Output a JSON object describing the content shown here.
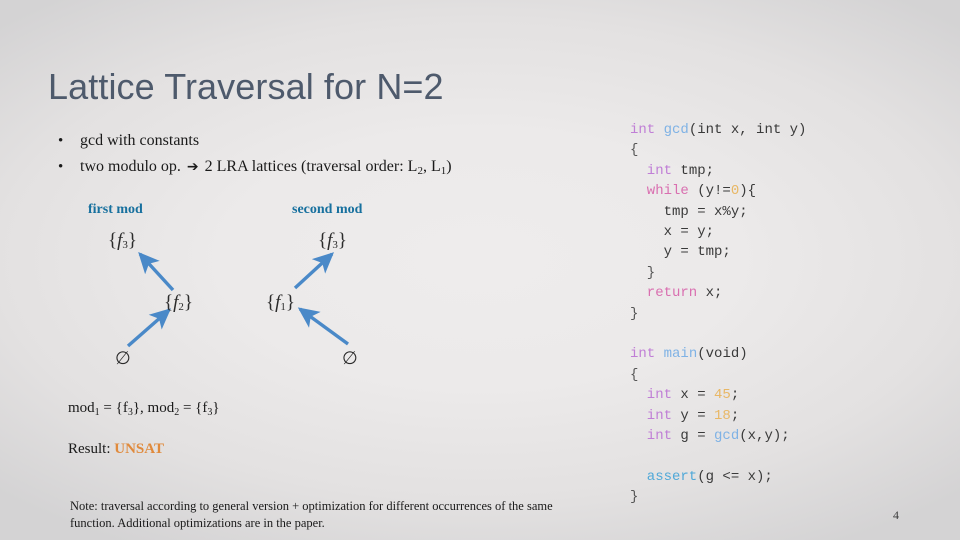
{
  "slide": {
    "title": "Lattice Traversal for N=2",
    "page_number": "4",
    "background_color": "#eceaea",
    "title_color": "#4e5a6c",
    "accent_blue": "#17709e",
    "arrow_color": "#4a89c8",
    "result_color": "#e08a3c"
  },
  "bullets": [
    {
      "marker": "•",
      "text": "gcd with constants"
    },
    {
      "marker": "•",
      "text_before_arrow": "two modulo op. ",
      "arrow": "➔",
      "text_after_arrow": " 2 LRA lattices (traversal order: L",
      "sub1": "2",
      "mid": ", L",
      "sub2": "1",
      "tail": ")"
    }
  ],
  "lattice": {
    "headers": [
      {
        "label": "first mod"
      },
      {
        "label": "second mod"
      }
    ],
    "left": {
      "top_node": {
        "open": "{",
        "fn": "f",
        "index": "3",
        "close": "}"
      },
      "mid_node": {
        "open": "{",
        "fn": "f",
        "index": "2",
        "close": "}"
      },
      "bottom_node": "∅"
    },
    "right": {
      "top_node": {
        "open": "{",
        "fn": "f",
        "index": "3",
        "close": "}"
      },
      "mid_node": {
        "open": "{",
        "fn": "f",
        "index": "1",
        "close": "}"
      },
      "bottom_node": "∅"
    }
  },
  "results": {
    "mod_line": {
      "m1_label": "mod",
      "m1_sub": "1",
      "m1_value": " = {f",
      "m1_value_sub": "3",
      "m1_value_end": "}, ",
      "m2_label": "mod",
      "m2_sub": "2",
      "m2_value": " = {f",
      "m2_value_sub": "3",
      "m2_value_end": "}"
    },
    "result_label": "Result: ",
    "result_verdict": "UNSAT"
  },
  "footnote": {
    "text": "Note: traversal according to general version + optimization for different occurrences of the same function. Additional optimizations are in the paper."
  },
  "code": {
    "gcd": {
      "line1_kw": "int",
      "line1_fn": " gcd",
      "line1_rest": "(int x, int y)",
      "line2": "{",
      "line3_kw": "  int",
      "line3_rest": " tmp;",
      "line4_kw": "  while",
      "line4_rest_a": " (y!=",
      "line4_num": "0",
      "line4_rest_b": "){",
      "line5": "    tmp = x%y;",
      "line6": "    x = y;",
      "line7": "    y = tmp;",
      "line8": "  }",
      "line9_kw": "  return",
      "line9_rest": " x;",
      "line10": "}"
    },
    "main": {
      "line1_kw": "int",
      "line1_fn": " main",
      "line1_rest": "(void)",
      "line2": "{",
      "line3_kw": "  int",
      "line3_mid": " x = ",
      "line3_num": "45",
      "line3_end": ";",
      "line4_kw": "  int",
      "line4_mid": " y = ",
      "line4_num": "18",
      "line4_end": ";",
      "line5_kw": "  int",
      "line5_mid": " g = ",
      "line5_fn": "gcd",
      "line5_end": "(x,y);",
      "line6_fn": "  assert",
      "line6_rest": "(g <= x);",
      "line7": "}"
    }
  }
}
